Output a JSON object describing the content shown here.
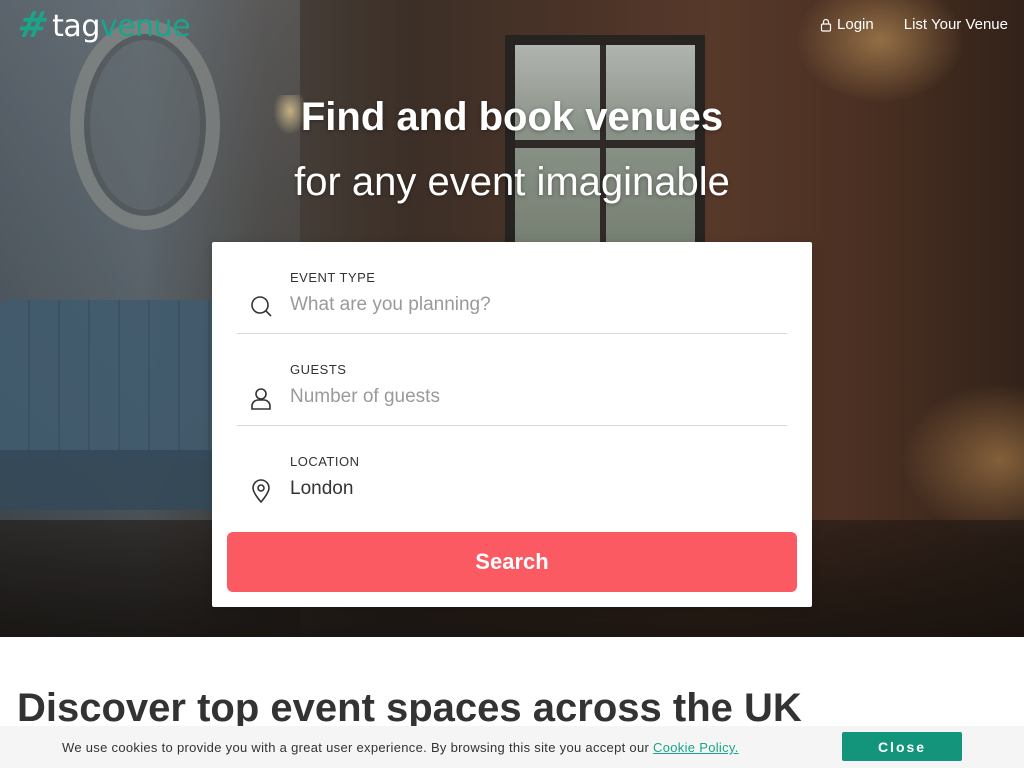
{
  "brand": {
    "logo_hash": "#",
    "logo_tag": "tag",
    "logo_venue": "venue",
    "accent_color": "#1aa58a"
  },
  "nav": {
    "login_label": "Login",
    "login_icon": "lock-icon",
    "list_venue_label": "List Your Venue"
  },
  "hero": {
    "title": "Find and book venues",
    "subtitle": "for any event imaginable"
  },
  "search": {
    "fields": [
      {
        "label": "EVENT TYPE",
        "placeholder": "What are you planning?",
        "value": "",
        "icon": "search-icon"
      },
      {
        "label": "GUESTS",
        "placeholder": "Number of guests",
        "value": "",
        "icon": "user-icon"
      },
      {
        "label": "LOCATION",
        "placeholder": "",
        "value": "London",
        "icon": "map-pin-icon"
      }
    ],
    "button_label": "Search",
    "button_color": "#fb5a63"
  },
  "section": {
    "title": "Discover top event spaces across the UK"
  },
  "cookie_bar": {
    "text": "We use cookies to provide you with a great user experience. By browsing this site you accept our ",
    "link_label": "Cookie Policy.",
    "close_label": "Close",
    "close_color": "#13957c"
  }
}
